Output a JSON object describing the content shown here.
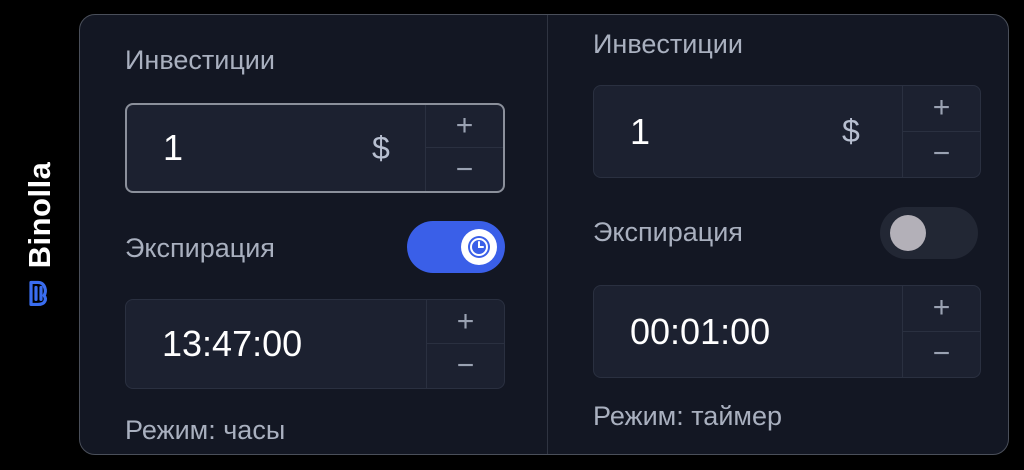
{
  "brand": {
    "name": "Binolla",
    "accent": "#3a5fe8"
  },
  "left_panel": {
    "investment_label": "Инвестиции",
    "investment_value": "1",
    "currency_symbol": "$",
    "stepper_plus": "+",
    "stepper_minus": "−",
    "expiration_label": "Экспирация",
    "expiration_toggle": "on",
    "toggle_icon": "clock-icon",
    "time_value": "13:47:00",
    "mode_text": "Режим: часы"
  },
  "right_panel": {
    "investment_label": "Инвестиции",
    "investment_value": "1",
    "currency_symbol": "$",
    "stepper_plus": "+",
    "stepper_minus": "−",
    "expiration_label": "Экспирация",
    "expiration_toggle": "off",
    "time_value": "00:01:00",
    "mode_text": "Режим: таймер"
  }
}
